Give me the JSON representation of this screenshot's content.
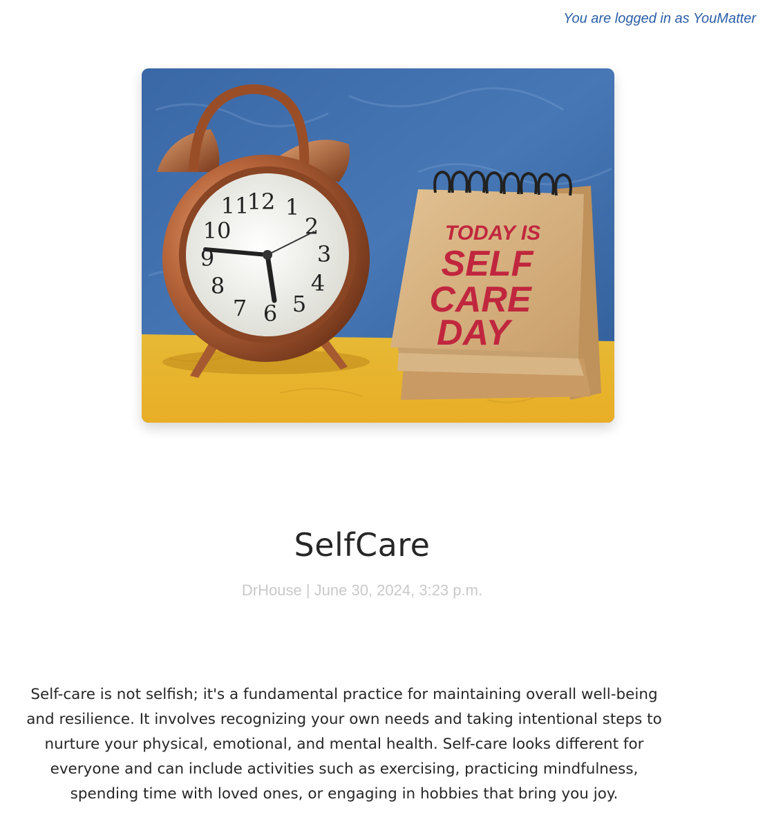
{
  "header": {
    "login_status": "You are logged in as YouMatter"
  },
  "hero_image": {
    "alt": "Alarm clock next to a desk calendar",
    "calendar_text": [
      "TODAY IS",
      "SELF",
      "CARE",
      "DAY"
    ],
    "clock_numbers": [
      "12",
      "1",
      "2",
      "3",
      "4",
      "5",
      "6",
      "7",
      "8",
      "9",
      "10",
      "11"
    ],
    "colors": {
      "background_blue": "#3e6aa8",
      "table_yellow": "#e8b92e",
      "copper": "#b8683a",
      "calendar_paper": "#d9b483",
      "lettering_red": "#c0273e"
    }
  },
  "post": {
    "title": "SelfCare",
    "meta": "DrHouse | June 30, 2024, 3:23 p.m.",
    "body": "Self-care is not selfish; it's a fundamental practice for maintaining overall well-being and resilience. It involves recognizing your own needs and taking intentional steps to nurture your physical, emotional, and mental health. Self-care looks different for everyone and can include activities such as exercising, practicing mindfulness, spending time with loved ones, or engaging in hobbies that bring you joy."
  }
}
